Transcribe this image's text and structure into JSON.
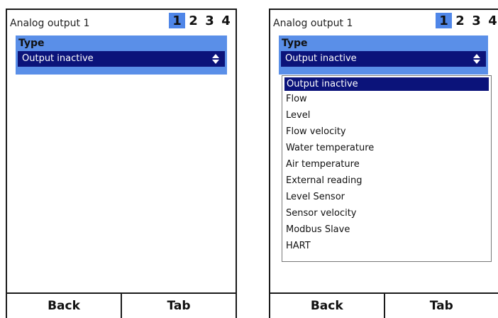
{
  "screens": [
    {
      "header": {
        "title": "Analog output 1",
        "pages": [
          "1",
          "2",
          "3",
          "4"
        ],
        "active_page": "1"
      },
      "type_label": "Type",
      "select_value": "Output inactive",
      "footer": {
        "back": "Back",
        "tab": "Tab"
      }
    },
    {
      "header": {
        "title": "Analog output 1",
        "pages": [
          "1",
          "2",
          "3",
          "4"
        ],
        "active_page": "1"
      },
      "type_label": "Type",
      "select_value": "Output inactive",
      "options": [
        "Output inactive",
        "Flow",
        "Level",
        "Flow velocity",
        "Water temperature",
        "Air temperature",
        "External reading",
        "Level Sensor",
        "Sensor velocity",
        "Modbus Slave",
        "HART"
      ],
      "selected_option": "Output inactive",
      "footer": {
        "back": "Back",
        "tab": "Tab"
      }
    }
  ],
  "colors": {
    "accent": "#5a8fe8",
    "select_bg": "#0b137a",
    "page_active": "#4f86e8"
  },
  "icons": {
    "select_arrow": "updown-arrow-icon"
  }
}
